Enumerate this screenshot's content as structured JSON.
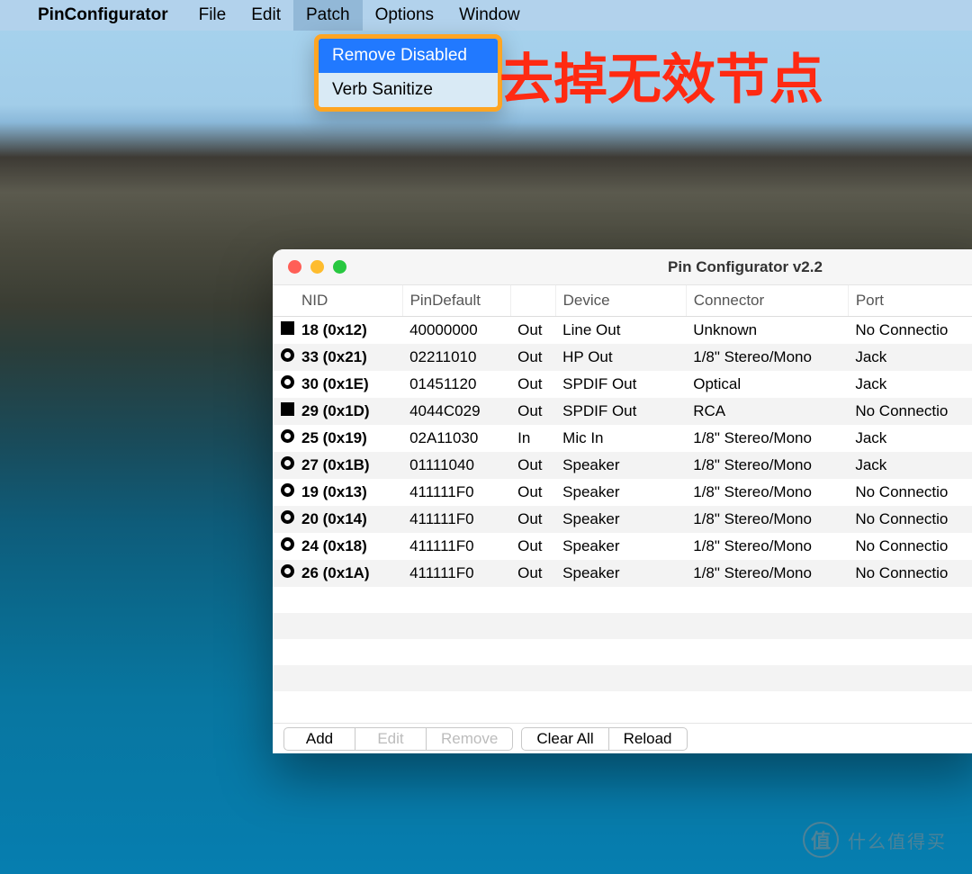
{
  "menubar": {
    "app_name": "PinConfigurator",
    "items": [
      "File",
      "Edit",
      "Patch",
      "Options",
      "Window"
    ],
    "active_index": 2,
    "dropdown": {
      "items": [
        "Remove Disabled",
        "Verb Sanitize"
      ],
      "selected_index": 0
    }
  },
  "annotation": "去掉无效节点",
  "window": {
    "title": "Pin Configurator v2.2",
    "columns": [
      "NID",
      "PinDefault",
      "",
      "Device",
      "Connector",
      "Port"
    ],
    "rows": [
      {
        "shape": "square",
        "nid": "18 (0x12)",
        "pindefault": "40000000",
        "dir": "Out",
        "device": "Line Out",
        "connector": "Unknown",
        "port": "No Connectio"
      },
      {
        "shape": "circle",
        "nid": "33 (0x21)",
        "pindefault": "02211010",
        "dir": "Out",
        "device": "HP Out",
        "connector": "1/8\" Stereo/Mono",
        "port": "Jack"
      },
      {
        "shape": "circle",
        "nid": "30 (0x1E)",
        "pindefault": "01451120",
        "dir": "Out",
        "device": "SPDIF Out",
        "connector": "Optical",
        "port": "Jack"
      },
      {
        "shape": "square",
        "nid": "29 (0x1D)",
        "pindefault": "4044C029",
        "dir": "Out",
        "device": "SPDIF Out",
        "connector": "RCA",
        "port": "No Connectio"
      },
      {
        "shape": "circle",
        "nid": "25 (0x19)",
        "pindefault": "02A11030",
        "dir": "In",
        "device": "Mic In",
        "connector": "1/8\" Stereo/Mono",
        "port": "Jack"
      },
      {
        "shape": "circle",
        "nid": "27 (0x1B)",
        "pindefault": "01111040",
        "dir": "Out",
        "device": "Speaker",
        "connector": "1/8\" Stereo/Mono",
        "port": "Jack"
      },
      {
        "shape": "circle",
        "nid": "19 (0x13)",
        "pindefault": "411111F0",
        "dir": "Out",
        "device": "Speaker",
        "connector": "1/8\" Stereo/Mono",
        "port": "No Connectio"
      },
      {
        "shape": "circle",
        "nid": "20 (0x14)",
        "pindefault": "411111F0",
        "dir": "Out",
        "device": "Speaker",
        "connector": "1/8\" Stereo/Mono",
        "port": "No Connectio"
      },
      {
        "shape": "circle",
        "nid": "24 (0x18)",
        "pindefault": "411111F0",
        "dir": "Out",
        "device": "Speaker",
        "connector": "1/8\" Stereo/Mono",
        "port": "No Connectio"
      },
      {
        "shape": "circle",
        "nid": "26 (0x1A)",
        "pindefault": "411111F0",
        "dir": "Out",
        "device": "Speaker",
        "connector": "1/8\" Stereo/Mono",
        "port": "No Connectio"
      }
    ],
    "buttons": {
      "add": "Add",
      "edit": "Edit",
      "remove": "Remove",
      "clear_all": "Clear All",
      "reload": "Reload"
    }
  },
  "watermark": {
    "icon": "值",
    "text": "什么值得买"
  }
}
